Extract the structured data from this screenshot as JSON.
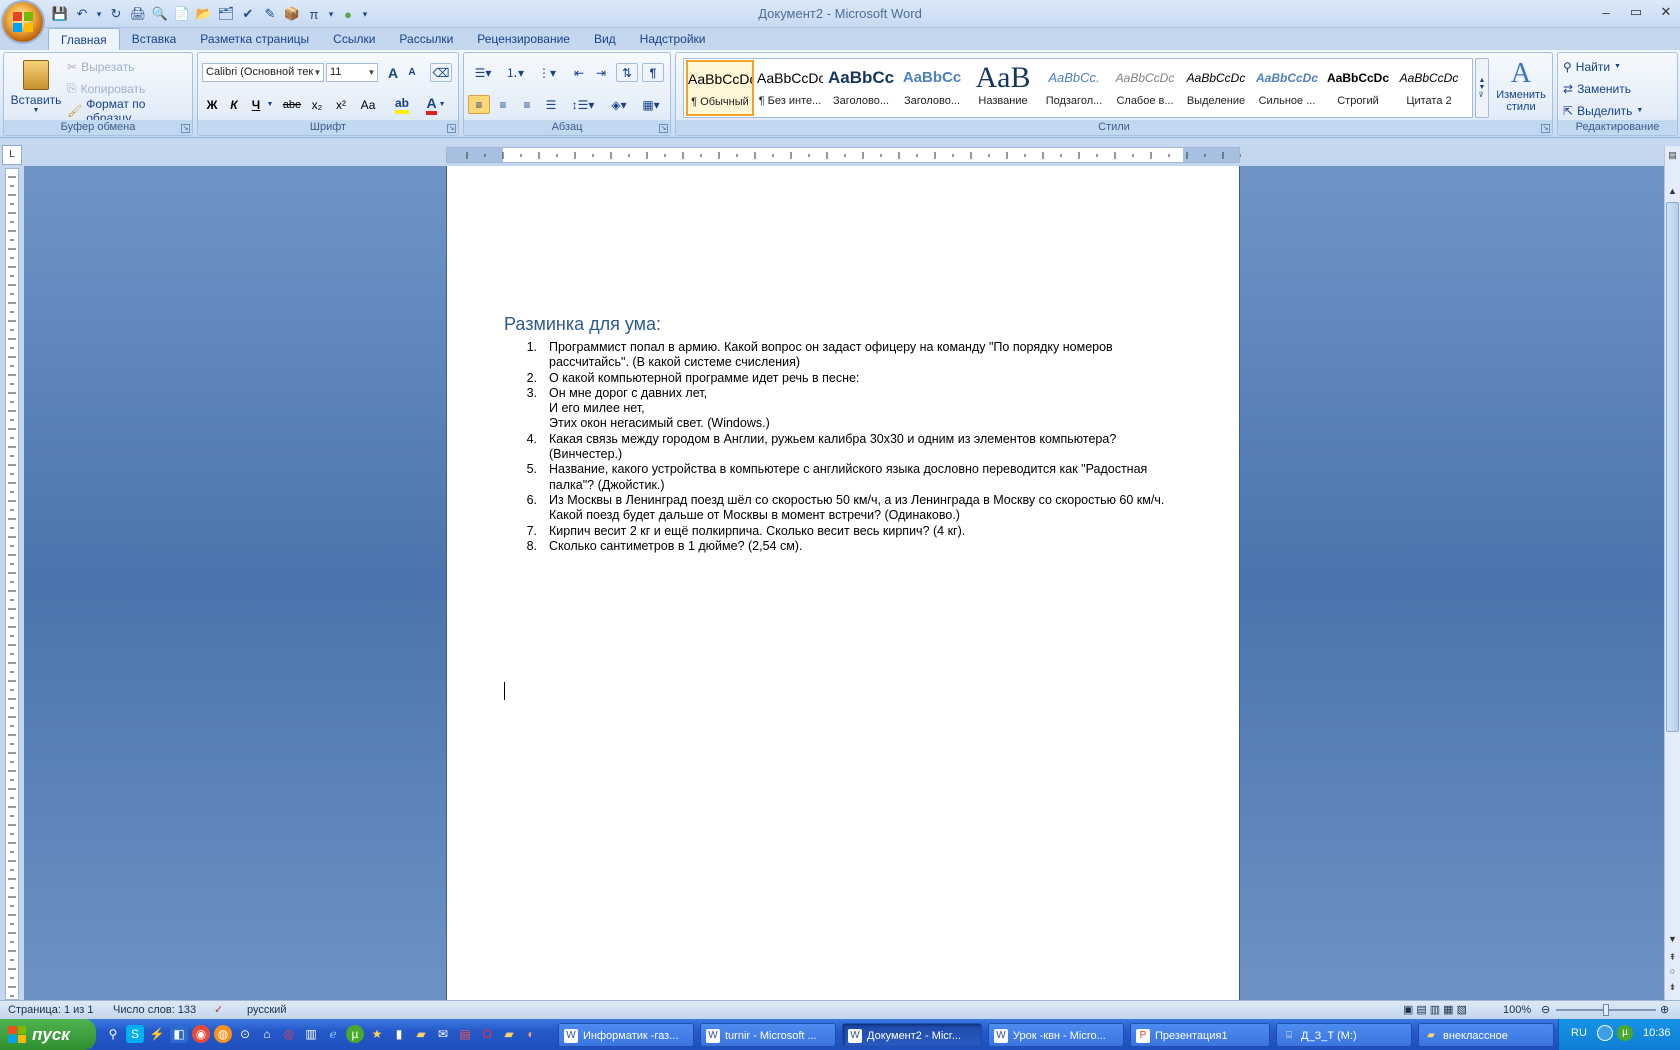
{
  "window": {
    "title": "Документ2 - Microsoft Word",
    "minimize": "–",
    "restore": "▭",
    "close": "✕"
  },
  "qat": [
    "💾",
    "↶",
    "▾",
    "↻",
    "🖨",
    "🔍",
    "📄",
    "📂",
    "🗂",
    "✔",
    "✎",
    "📦",
    "π",
    "▾",
    "●",
    "▾"
  ],
  "tabs": [
    "Главная",
    "Вставка",
    "Разметка страницы",
    "Ссылки",
    "Рассылки",
    "Рецензирование",
    "Вид",
    "Надстройки"
  ],
  "clipboard": {
    "paste": "Вставить",
    "cut": "Вырезать",
    "copy": "Копировать",
    "format_painter": "Формат по образцу",
    "label": "Буфер обмена"
  },
  "font": {
    "name": "Calibri (Основной тек",
    "size": "11",
    "grow": "A",
    "shrink": "A",
    "bold": "Ж",
    "italic": "К",
    "underline": "Ч",
    "strike": "abe",
    "sub": "x₂",
    "sup": "x²",
    "case": "Аа",
    "label": "Шрифт"
  },
  "paragraph": {
    "label": "Абзац",
    "pilcrow": "¶"
  },
  "styles": {
    "label": "Стили",
    "items": [
      {
        "sample": "AaBbCcDc",
        "name": "¶ Обычный"
      },
      {
        "sample": "AaBbCcDc",
        "name": "¶ Без инте..."
      },
      {
        "sample": "AaBbCc",
        "name": "Заголово..."
      },
      {
        "sample": "AaBbCc",
        "name": "Заголово..."
      },
      {
        "sample": "AaB",
        "name": "Название"
      },
      {
        "sample": "AaBbCc.",
        "name": "Подзагол..."
      },
      {
        "sample": "AaBbCcDc",
        "name": "Слабое в..."
      },
      {
        "sample": "AaBbCcDc",
        "name": "Выделение"
      },
      {
        "sample": "AaBbCcDc",
        "name": "Сильное ..."
      },
      {
        "sample": "AaBbCcDc",
        "name": "Строгий"
      },
      {
        "sample": "AaBbCcDc",
        "name": "Цитата 2"
      }
    ],
    "change": "Изменить стили"
  },
  "editing": {
    "find": "Найти",
    "replace": "Заменить",
    "select": "Выделить",
    "label": "Редактирование"
  },
  "ruler": {
    "corner": "L"
  },
  "document": {
    "heading": "Разминка для ума:",
    "items": [
      {
        "num": "1.",
        "text": "Программист попал в армию. Какой вопрос он задаст офицеру на команду \"По порядку номеров рассчитайсь\". (В какой системе счисления)"
      },
      {
        "num": "2.",
        "text": "О какой компьютерной программе идет речь в песне:"
      },
      {
        "num": "3.",
        "text": "Он мне дорог с давних лет,"
      },
      {
        "num": "",
        "text": "И его милее нет,"
      },
      {
        "num": "",
        "text": "Этих окон негасимый свет. (Windows.)"
      },
      {
        "num": "4.",
        "text": "Какая связь между городом в Англии, ружьем калибра 30х30 и одним из элементов компьютера? (Винчестер.)"
      },
      {
        "num": "5.",
        "text": "Название, какого устройства в компьютере с английского языка дословно переводится как \"Радостная палка\"? (Джойстик.)"
      },
      {
        "num": "6.",
        "text": "Из Москвы в Ленинград поезд шёл со скоростью 50 км/ч, а из Ленинграда в Москву со скоростью 60 км/ч. Какой поезд будет дальше от Москвы в момент встречи? (Одинаково.)"
      },
      {
        "num": "7.",
        "text": "Кирпич весит 2 кг и ещё полкирпича. Сколько весит весь кирпич? (4 кг)."
      },
      {
        "num": "8.",
        "text": "Сколько сантиметров в 1 дюйме? (2,54 см)."
      }
    ]
  },
  "status": {
    "page": "Страница: 1 из 1",
    "words": "Число слов: 133",
    "lang": "русский",
    "zoom": "100%",
    "minus": "⊖",
    "plus": "⊕"
  },
  "taskbar": {
    "start": "пуск",
    "tasks": [
      "Информатик -газ...",
      "turnir - Microsoft ...",
      "Документ2 - Micr...",
      "Урок -квн - Micro...",
      "Презентация1",
      "Д_З_Т (M:)",
      "внеклассное"
    ],
    "lang": "RU",
    "clock": "10:36"
  }
}
